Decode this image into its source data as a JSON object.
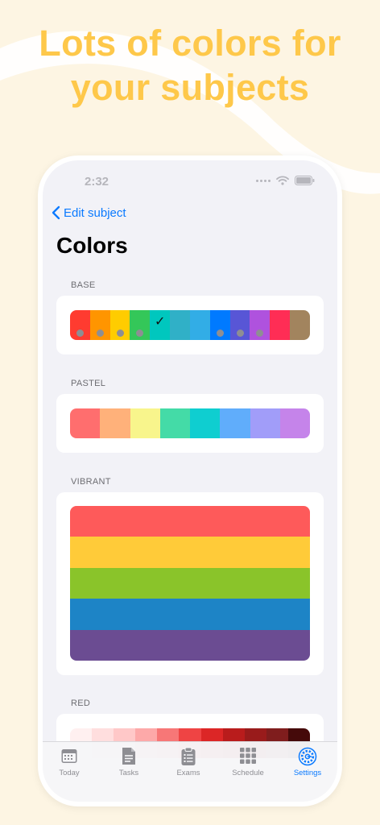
{
  "headline": {
    "line1": "Lots of colors for",
    "line2": "your subjects"
  },
  "status": {
    "time": "2:32"
  },
  "nav": {
    "back_label": "Edit subject",
    "title": "Colors"
  },
  "sections": {
    "base": {
      "label": "BASE",
      "swatches": [
        {
          "color": "#ff3b30",
          "dot": true
        },
        {
          "color": "#ff9500",
          "dot": true
        },
        {
          "color": "#ffcc00",
          "dot": true
        },
        {
          "color": "#34c759",
          "dot": true
        },
        {
          "color": "#00c7be",
          "dot": false,
          "selected": true
        },
        {
          "color": "#30b0c7",
          "dot": false
        },
        {
          "color": "#32ade6",
          "dot": false
        },
        {
          "color": "#007aff",
          "dot": true
        },
        {
          "color": "#5856d6",
          "dot": true
        },
        {
          "color": "#af52de",
          "dot": true
        },
        {
          "color": "#ff2d55",
          "dot": false
        },
        {
          "color": "#a2845e",
          "dot": false
        }
      ],
      "check": "✓"
    },
    "pastel": {
      "label": "PASTEL",
      "swatches": [
        "#ff6e6e",
        "#ffb17a",
        "#f8f58c",
        "#44dba7",
        "#0fced0",
        "#60adfb",
        "#a19df9",
        "#c584ea"
      ]
    },
    "vibrant": {
      "label": "VIBRANT",
      "swatches": [
        "#fe5a5a",
        "#ffcb39",
        "#8ac42a",
        "#1d84c6",
        "#6b4c92"
      ]
    },
    "red": {
      "label": "RED",
      "swatches": [
        "#fff0f0",
        "#ffdede",
        "#ffc8c8",
        "#fda9a9",
        "#f77777",
        "#ef4444",
        "#dc2626",
        "#b91c1c",
        "#991b1b",
        "#7f1d1d",
        "#450a0a"
      ]
    }
  },
  "tabs": [
    {
      "label": "Today",
      "icon": "calendar-icon"
    },
    {
      "label": "Tasks",
      "icon": "document-icon"
    },
    {
      "label": "Exams",
      "icon": "clipboard-icon"
    },
    {
      "label": "Schedule",
      "icon": "grid-icon"
    },
    {
      "label": "Settings",
      "icon": "gear-icon",
      "active": true
    }
  ],
  "colors": {
    "background": "#fdf5e3",
    "headline": "#fec84a",
    "accent": "#0a7aff",
    "tab_inactive": "#8e8e93"
  }
}
